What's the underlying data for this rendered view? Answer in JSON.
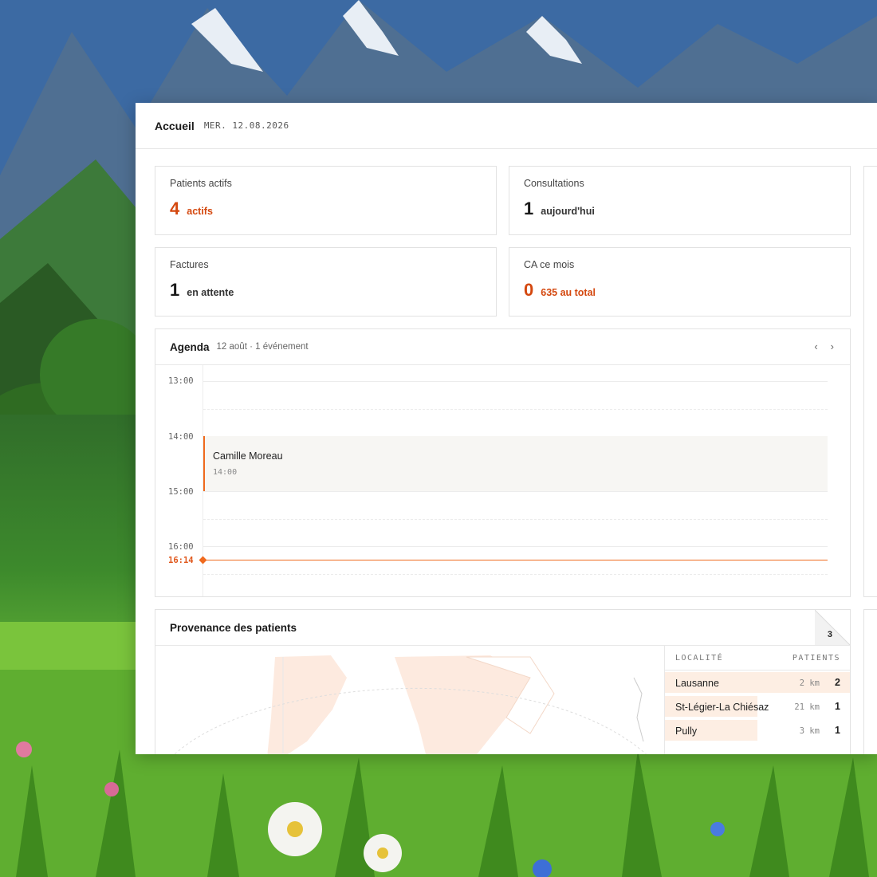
{
  "header": {
    "title": "Accueil",
    "date": "MER. 12.08.2026"
  },
  "stats": [
    {
      "label": "Patients actifs",
      "value": "4",
      "unit": "actifs"
    },
    {
      "label": "Consultations",
      "value": "1",
      "unit": "aujourd'hui"
    },
    {
      "label": "Factures",
      "value": "1",
      "unit": "en attente"
    },
    {
      "label": "CA ce mois",
      "value": "0",
      "unit": "635 au total"
    }
  ],
  "agenda": {
    "title": "Agenda",
    "subtitle": "12 août · 1 événement",
    "prev_label": "‹",
    "next_label": "›",
    "hours": [
      "13:00",
      "14:00",
      "15:00",
      "16:00"
    ],
    "event": {
      "name": "Camille Moreau",
      "time": "14:00"
    },
    "now": "16:14"
  },
  "provenance": {
    "title": "Provenance des patients",
    "count": "3",
    "table": {
      "col_locality": "LOCALITÉ",
      "col_patients": "PATIENTS",
      "rows": [
        {
          "name": "Lausanne",
          "distance": "2 km",
          "count": "2"
        },
        {
          "name": "St-Légier-La Chiésaz",
          "distance": "21 km",
          "count": "1"
        },
        {
          "name": "Pully",
          "distance": "3 km",
          "count": "1"
        }
      ]
    }
  },
  "colors": {
    "accent": "#f06a1e",
    "accent_text": "#d4480f",
    "highlight": "#fdeee3"
  }
}
